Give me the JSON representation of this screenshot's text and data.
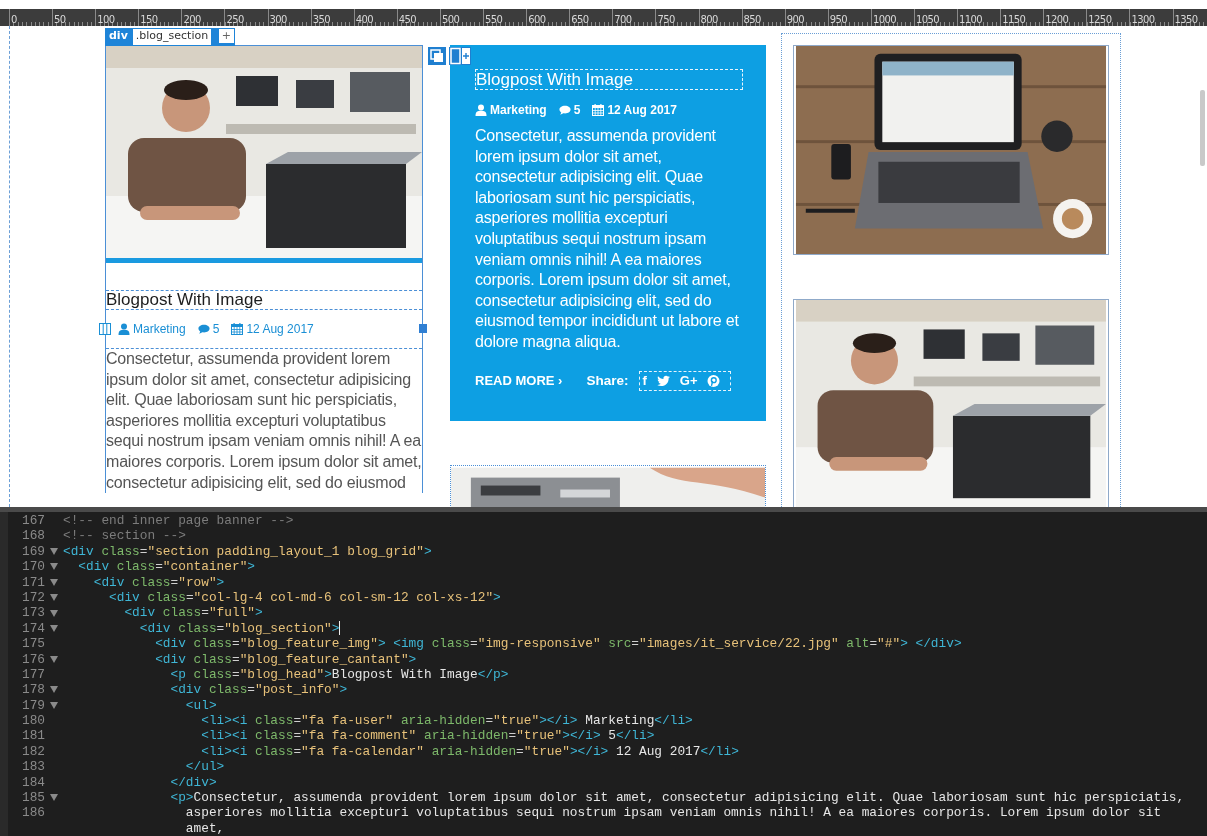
{
  "ruler": {
    "marks": [
      "0",
      "50",
      "100",
      "150",
      "200",
      "250",
      "300",
      "350",
      "400",
      "450",
      "500",
      "550",
      "600",
      "650",
      "700",
      "750",
      "800",
      "850",
      "900",
      "950",
      "1000",
      "1050",
      "1100",
      "1150",
      "1200",
      "1250",
      "1300",
      "1350"
    ]
  },
  "selection_tag": {
    "tag": "div",
    "class": ".blog_section",
    "button": "+"
  },
  "left_post": {
    "title": "Blogpost With Image",
    "meta": [
      {
        "kind": "user",
        "text": "Marketing"
      },
      {
        "kind": "comment",
        "text": "5"
      },
      {
        "kind": "calendar",
        "text": "12 Aug 2017"
      }
    ],
    "body": "Consectetur, assumenda provident lorem ipsum dolor sit amet, consectetur adipisicing elit. Quae laboriosam sunt hic perspiciatis, asperiores mollitia excepturi voluptatibus sequi nostrum ipsam veniam omnis nihil! A ea maiores corporis. Lorem ipsum dolor sit amet, consectetur adipisicing elit, sed do eiusmod"
  },
  "featured_post": {
    "title": "Blogpost With Image",
    "meta": [
      {
        "kind": "user",
        "text": "Marketing"
      },
      {
        "kind": "comment",
        "text": "5"
      },
      {
        "kind": "calendar",
        "text": "12 Aug 2017"
      }
    ],
    "body": "Consectetur, assumenda provident lorem ipsum dolor sit amet, consectetur adipisicing elit. Quae laboriosam sunt hic perspiciatis, asperiores mollitia excepturi voluptatibus sequi nostrum ipsam veniam omnis nihil! A ea maiores corporis. Lorem ipsum dolor sit amet, consectetur adipisicing elit, sed do eiusmod tempor incididunt ut labore et dolore magna aliqua.",
    "read_more": "READ MORE ›",
    "share_label": "Share:",
    "share": [
      {
        "kind": "facebook",
        "label": "f"
      },
      {
        "kind": "twitter"
      },
      {
        "kind": "google",
        "label": "G+"
      },
      {
        "kind": "pinterest"
      }
    ]
  },
  "code_editor": {
    "lines": [
      {
        "number": "167",
        "fold": false,
        "cursor": false,
        "tokens": [
          {
            "kind": "comment",
            "text": "<!-- end inner page banner -->"
          }
        ]
      },
      {
        "number": "168",
        "fold": false,
        "cursor": false,
        "tokens": [
          {
            "kind": "comment",
            "text": "<!-- section -->"
          }
        ]
      },
      {
        "number": "169",
        "fold": true,
        "cursor": false,
        "tokens": [
          {
            "kind": "tag",
            "text": "<div"
          },
          {
            "kind": "attr",
            "text": " class"
          },
          {
            "kind": "punct",
            "text": "="
          },
          {
            "kind": "string",
            "text": "\"section padding_layout_1 blog_grid\""
          },
          {
            "kind": "tag",
            "text": ">"
          }
        ]
      },
      {
        "number": "170",
        "fold": true,
        "cursor": false,
        "tokens": [
          {
            "kind": "tag",
            "text": "  <div"
          },
          {
            "kind": "attr",
            "text": " class"
          },
          {
            "kind": "punct",
            "text": "="
          },
          {
            "kind": "string",
            "text": "\"container\""
          },
          {
            "kind": "tag",
            "text": ">"
          }
        ]
      },
      {
        "number": "171",
        "fold": true,
        "cursor": false,
        "tokens": [
          {
            "kind": "tag",
            "text": "    <div"
          },
          {
            "kind": "attr",
            "text": " class"
          },
          {
            "kind": "punct",
            "text": "="
          },
          {
            "kind": "string",
            "text": "\"row\""
          },
          {
            "kind": "tag",
            "text": ">"
          }
        ]
      },
      {
        "number": "172",
        "fold": true,
        "cursor": false,
        "tokens": [
          {
            "kind": "tag",
            "text": "      <div"
          },
          {
            "kind": "attr",
            "text": " class"
          },
          {
            "kind": "punct",
            "text": "="
          },
          {
            "kind": "string",
            "text": "\"col-lg-4 col-md-6 col-sm-12 col-xs-12\""
          },
          {
            "kind": "tag",
            "text": ">"
          }
        ]
      },
      {
        "number": "173",
        "fold": true,
        "cursor": false,
        "tokens": [
          {
            "kind": "tag",
            "text": "        <div"
          },
          {
            "kind": "attr",
            "text": " class"
          },
          {
            "kind": "punct",
            "text": "="
          },
          {
            "kind": "string",
            "text": "\"full\""
          },
          {
            "kind": "tag",
            "text": ">"
          }
        ]
      },
      {
        "number": "174",
        "fold": true,
        "cursor": true,
        "tokens": [
          {
            "kind": "tag",
            "text": "          <div"
          },
          {
            "kind": "attr",
            "text": " class"
          },
          {
            "kind": "punct",
            "text": "="
          },
          {
            "kind": "string",
            "text": "\"blog_section\""
          },
          {
            "kind": "tag",
            "text": ">"
          }
        ]
      },
      {
        "number": "175",
        "fold": false,
        "cursor": false,
        "tokens": [
          {
            "kind": "tag",
            "text": "            <div"
          },
          {
            "kind": "attr",
            "text": " class"
          },
          {
            "kind": "punct",
            "text": "="
          },
          {
            "kind": "string",
            "text": "\"blog_feature_img\""
          },
          {
            "kind": "tag",
            "text": ">"
          },
          {
            "kind": "tag",
            "text": " <img"
          },
          {
            "kind": "attr",
            "text": " class"
          },
          {
            "kind": "punct",
            "text": "="
          },
          {
            "kind": "string",
            "text": "\"img-responsive\""
          },
          {
            "kind": "attr",
            "text": " src"
          },
          {
            "kind": "punct",
            "text": "="
          },
          {
            "kind": "string",
            "text": "\"images/it_service/22.jpg\""
          },
          {
            "kind": "attr",
            "text": " alt"
          },
          {
            "kind": "punct",
            "text": "="
          },
          {
            "kind": "string",
            "text": "\"#\""
          },
          {
            "kind": "tag",
            "text": ">"
          },
          {
            "kind": "tag",
            "text": " </div>"
          }
        ]
      },
      {
        "number": "176",
        "fold": true,
        "cursor": false,
        "tokens": [
          {
            "kind": "tag",
            "text": "            <div"
          },
          {
            "kind": "attr",
            "text": " class"
          },
          {
            "kind": "punct",
            "text": "="
          },
          {
            "kind": "string",
            "text": "\"blog_feature_cantant\""
          },
          {
            "kind": "tag",
            "text": ">"
          }
        ]
      },
      {
        "number": "177",
        "fold": false,
        "cursor": false,
        "tokens": [
          {
            "kind": "tag",
            "text": "              <p"
          },
          {
            "kind": "attr",
            "text": " class"
          },
          {
            "kind": "punct",
            "text": "="
          },
          {
            "kind": "string",
            "text": "\"blog_head\""
          },
          {
            "kind": "tag",
            "text": ">"
          },
          {
            "kind": "text",
            "text": "Blogpost With Image"
          },
          {
            "kind": "tag",
            "text": "</p>"
          }
        ]
      },
      {
        "number": "178",
        "fold": true,
        "cursor": false,
        "tokens": [
          {
            "kind": "tag",
            "text": "              <div"
          },
          {
            "kind": "attr",
            "text": " class"
          },
          {
            "kind": "punct",
            "text": "="
          },
          {
            "kind": "string",
            "text": "\"post_info\""
          },
          {
            "kind": "tag",
            "text": ">"
          }
        ]
      },
      {
        "number": "179",
        "fold": true,
        "cursor": false,
        "tokens": [
          {
            "kind": "tag",
            "text": "                <ul>"
          }
        ]
      },
      {
        "number": "180",
        "fold": false,
        "cursor": false,
        "tokens": [
          {
            "kind": "tag",
            "text": "                  <li><i"
          },
          {
            "kind": "attr",
            "text": " class"
          },
          {
            "kind": "punct",
            "text": "="
          },
          {
            "kind": "string",
            "text": "\"fa fa-user\""
          },
          {
            "kind": "attr",
            "text": " aria-hidden"
          },
          {
            "kind": "punct",
            "text": "="
          },
          {
            "kind": "string",
            "text": "\"true\""
          },
          {
            "kind": "tag",
            "text": "></i>"
          },
          {
            "kind": "text",
            "text": " Marketing"
          },
          {
            "kind": "tag",
            "text": "</li>"
          }
        ]
      },
      {
        "number": "181",
        "fold": false,
        "cursor": false,
        "tokens": [
          {
            "kind": "tag",
            "text": "                  <li><i"
          },
          {
            "kind": "attr",
            "text": " class"
          },
          {
            "kind": "punct",
            "text": "="
          },
          {
            "kind": "string",
            "text": "\"fa fa-comment\""
          },
          {
            "kind": "attr",
            "text": " aria-hidden"
          },
          {
            "kind": "punct",
            "text": "="
          },
          {
            "kind": "string",
            "text": "\"true\""
          },
          {
            "kind": "tag",
            "text": "></i>"
          },
          {
            "kind": "text",
            "text": " 5"
          },
          {
            "kind": "tag",
            "text": "</li>"
          }
        ]
      },
      {
        "number": "182",
        "fold": false,
        "cursor": false,
        "tokens": [
          {
            "kind": "tag",
            "text": "                  <li><i"
          },
          {
            "kind": "attr",
            "text": " class"
          },
          {
            "kind": "punct",
            "text": "="
          },
          {
            "kind": "string",
            "text": "\"fa fa-calendar\""
          },
          {
            "kind": "attr",
            "text": " aria-hidden"
          },
          {
            "kind": "punct",
            "text": "="
          },
          {
            "kind": "string",
            "text": "\"true\""
          },
          {
            "kind": "tag",
            "text": "></i>"
          },
          {
            "kind": "text",
            "text": " 12 Aug 2017"
          },
          {
            "kind": "tag",
            "text": "</li>"
          }
        ]
      },
      {
        "number": "183",
        "fold": false,
        "cursor": false,
        "tokens": [
          {
            "kind": "tag",
            "text": "                </ul>"
          }
        ]
      },
      {
        "number": "184",
        "fold": false,
        "cursor": false,
        "tokens": [
          {
            "kind": "tag",
            "text": "              </div>"
          }
        ]
      },
      {
        "number": "185",
        "fold": true,
        "cursor": false,
        "tokens": [
          {
            "kind": "tag",
            "text": "              <p>"
          },
          {
            "kind": "text",
            "text": "Consectetur, assumenda provident lorem ipsum dolor sit amet, consectetur adipisicing elit. Quae laboriosam sunt hic perspiciatis,"
          }
        ]
      },
      {
        "number": "186",
        "fold": false,
        "cursor": false,
        "tokens": [
          {
            "kind": "text",
            "text": "                asperiores mollitia excepturi voluptatibus sequi nostrum ipsam veniam omnis nihil! A ea maiores corporis. Lorem ipsum dolor sit"
          }
        ]
      },
      {
        "fold": false,
        "cursor": false,
        "tokens": [
          {
            "kind": "text",
            "text": "                amet,"
          }
        ]
      }
    ]
  }
}
